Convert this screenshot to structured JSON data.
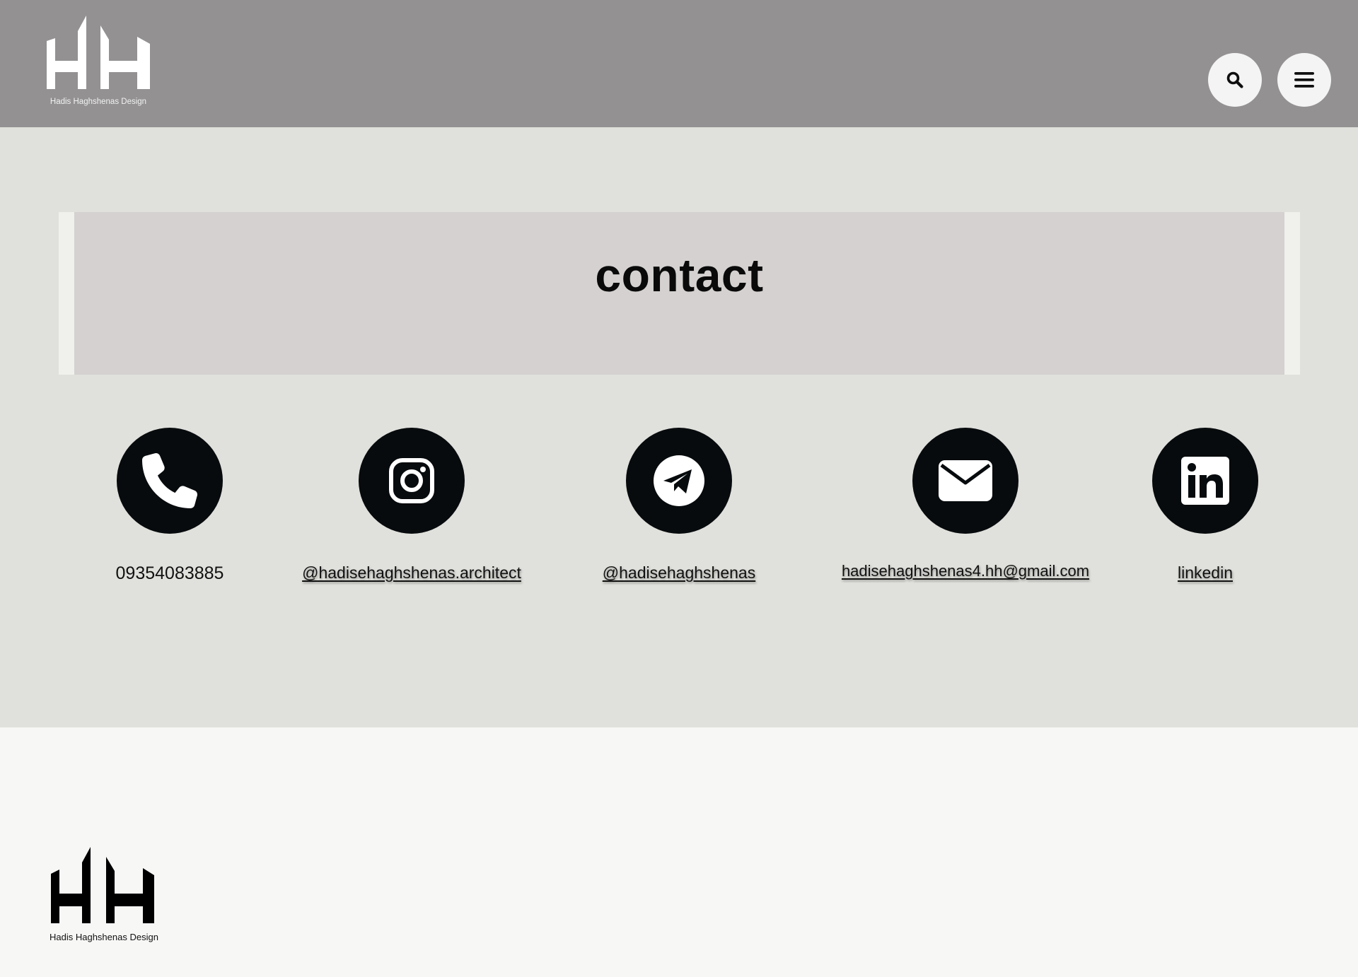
{
  "header": {
    "logo_text": "Hadis Haghshenas Design",
    "search_icon": "search-icon",
    "menu_icon": "hamburger-menu-icon",
    "background": "#939192"
  },
  "main": {
    "title": "contact",
    "background": "#e0e0dc",
    "contacts": [
      {
        "icon": "phone-icon",
        "label": "09354083885"
      },
      {
        "icon": "instagram-icon",
        "label": "@hadisehaghshenas.architect"
      },
      {
        "icon": "telegram-icon",
        "label": "@hadisehaghshenas"
      },
      {
        "icon": "email-icon",
        "label": "hadisehaghshenas4.hh@gmail.com"
      },
      {
        "icon": "linkedin-icon",
        "label": "linkedin"
      }
    ]
  },
  "footer": {
    "logo_text": "Hadis Haghshenas Design"
  }
}
